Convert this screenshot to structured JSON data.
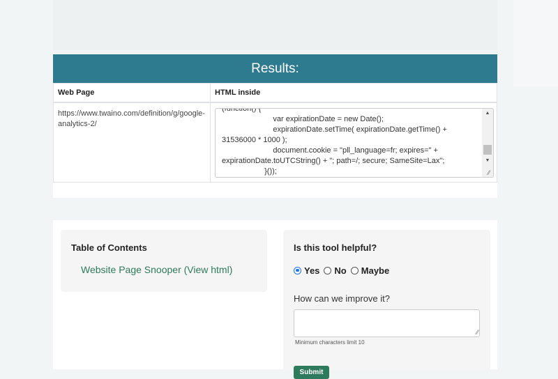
{
  "results": {
    "title": "Results:",
    "col_web_page": "Web Page",
    "col_html": "HTML inside",
    "url": "https://www.twaino.com/definition/g/google-analytics-2/",
    "code": "(function() {\n                        var expirationDate = new Date();\n                        expirationDate.setTime( expirationDate.getTime() + 31536000 * 1000 );\n                        document.cookie = \"pll_language=fr; expires=\" + expirationDate.toUTCString() + \"; path=/; secure; SameSite=Lax\";\n                    }());"
  },
  "toc": {
    "title": "Table of Contents",
    "link": "Website Page Snooper (View html)"
  },
  "feedback": {
    "title": "Is this tool helpful?",
    "options": [
      "Yes",
      "No",
      "Maybe"
    ],
    "selected": "Yes",
    "improve_label": "How can we improve it?",
    "min_chars": "Minimum characters limit 10",
    "submit": "Submit"
  },
  "colors": {
    "header_bg": "#2e7a8f",
    "accent_green": "#2e7a5c",
    "radio_blue": "#1a73e8"
  },
  "icons": {
    "scroll_up": "triangle-up-icon",
    "scroll_down": "triangle-down-icon",
    "resize": "resize-grip-icon"
  }
}
